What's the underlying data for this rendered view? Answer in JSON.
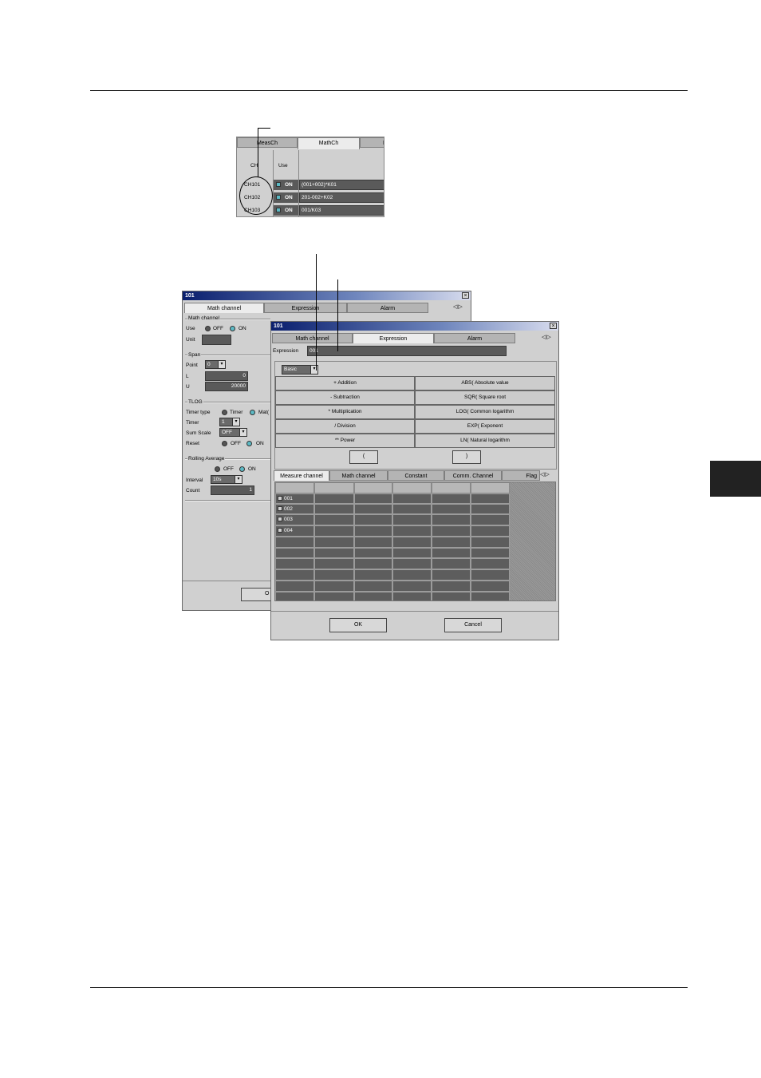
{
  "top_table": {
    "tabs": [
      "MeasCh",
      "MathCh",
      "E"
    ],
    "headers": {
      "ch": "CH",
      "use": "Use"
    },
    "rows": [
      {
        "ch": "CH101",
        "use": "ON",
        "expr": "(001+002)*K01"
      },
      {
        "ch": "CH102",
        "use": "ON",
        "expr": "201-002+K02"
      },
      {
        "ch": "CH103",
        "use": "ON",
        "expr": "001/K03"
      }
    ]
  },
  "back_window": {
    "title": "101",
    "close": "×",
    "tabs": [
      "Math channel",
      "Expression",
      "Alarm"
    ],
    "nav": "◁▷",
    "math_channel": {
      "group": "Math channel",
      "use_label": "Use",
      "off": "OFF",
      "on": "ON",
      "unit_label": "Unit"
    },
    "span": {
      "group": "Span",
      "point_label": "Point",
      "point_value": "0",
      "l_label": "L",
      "l_value": "0",
      "u_label": "U",
      "u_value": "20000"
    },
    "tlog": {
      "group": "TLOG",
      "timer_type_label": "Timer type",
      "timer_opt": "Timer",
      "match_opt": "Mat(",
      "timer_label": "Timer",
      "timer_value": "1",
      "sum_scale_label": "Sum Scale",
      "sum_scale_value": "OFF",
      "reset_label": "Reset",
      "off": "OFF",
      "on": "ON"
    },
    "rolling": {
      "group": "Rolling Average",
      "off": "OFF",
      "on": "ON",
      "interval_label": "Interval",
      "interval_value": "10s",
      "count_label": "Count",
      "count_value": "1"
    },
    "ok_partial": "O"
  },
  "front_window": {
    "title": "101",
    "close": "×",
    "tabs": [
      "Math channel",
      "Expression",
      "Alarm"
    ],
    "nav": "◁▷",
    "expression_label": "Expression",
    "expression_value": "001",
    "func_select": "Basic",
    "func_buttons": [
      [
        "+ Addition",
        "ABS( Absolute value"
      ],
      [
        "- Subtraction",
        "SQR( Square root"
      ],
      [
        "* Multiplication",
        "LOG( Common logarithm"
      ],
      [
        "/ Division",
        "EXP( Exponent"
      ],
      [
        "** Power",
        "LN( Natural logarithm"
      ]
    ],
    "paren_open": "(",
    "paren_close": ")",
    "channel_tabs": [
      "Measure channel",
      "Math channel",
      "Constant",
      "Comm. Channel",
      "Flag"
    ],
    "channels": [
      "001",
      "002",
      "003",
      "004"
    ],
    "ok": "OK",
    "cancel": "Cancel"
  },
  "colors": {
    "title_dark": "#0a1f6e",
    "radio_on": "#5cb9c4",
    "side_tab": "#222222"
  }
}
